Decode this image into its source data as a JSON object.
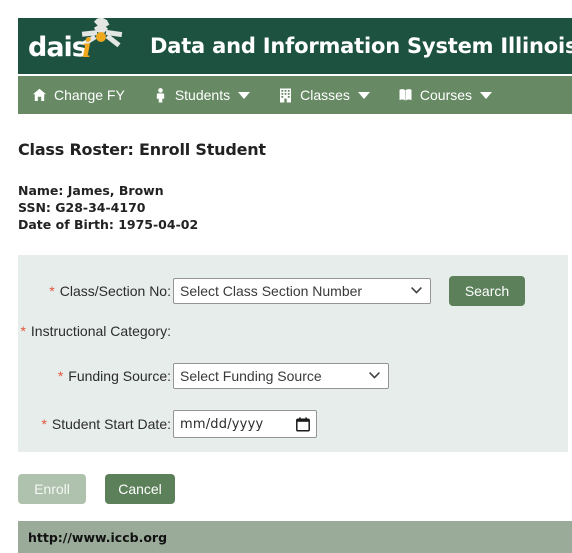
{
  "header": {
    "logo_word": "dais",
    "logo_letter": "i",
    "title": "Data and Information System Illinois",
    "bar_color": "#1d5240"
  },
  "nav": {
    "bar_color": "#678a64",
    "items": [
      {
        "label": "Change FY",
        "icon": "home-icon",
        "has_caret": false
      },
      {
        "label": "Students",
        "icon": "person-icon",
        "has_caret": true
      },
      {
        "label": "Classes",
        "icon": "building-icon",
        "has_caret": true
      },
      {
        "label": "Courses",
        "icon": "book-icon",
        "has_caret": true
      }
    ]
  },
  "page": {
    "title": "Class Roster: Enroll Student",
    "student": {
      "name_line": "Name: James, Brown",
      "ssn_line": "SSN: G28-34-4170",
      "dob_line": "Date of Birth: 1975-04-02"
    }
  },
  "form": {
    "required_marker": "*",
    "class_section": {
      "label": "Class/Section No:",
      "selected": "Select Class Section Number",
      "options": [
        "Select Class Section Number"
      ]
    },
    "search_label": "Search",
    "instructional_category": {
      "label": "Instructional Category:",
      "value": ""
    },
    "funding_source": {
      "label": "Funding Source:",
      "selected": "Select Funding Source",
      "options": [
        "Select Funding Source"
      ]
    },
    "start_date": {
      "label": "Student Start Date:",
      "placeholder": "mm/dd/yyyy",
      "value": ""
    }
  },
  "actions": {
    "enroll_label": "Enroll",
    "cancel_label": "Cancel"
  },
  "footer": {
    "link_text": "http://www.iccb.org",
    "bar_color": "#9aab99"
  }
}
